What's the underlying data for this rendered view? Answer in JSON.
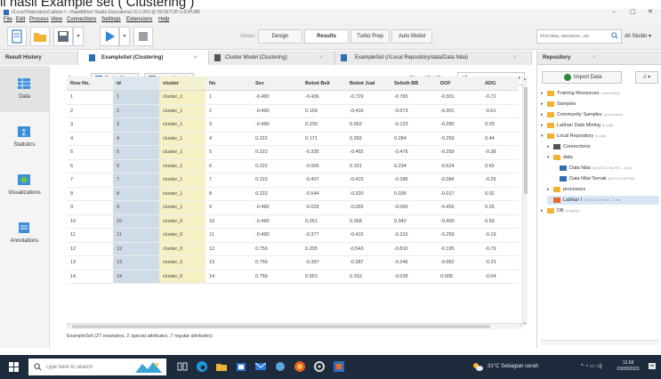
{
  "caption": "il hasil Example set ( Clustering )",
  "titlebar": {
    "title": "//Local Repository/Latihan I – RapidMiner Studio Educational 10.1.003 @ DESKTOP-UJDPU8B",
    "minimize": "–",
    "maximize": "▢",
    "close": "✕"
  },
  "menubar": [
    "File",
    "Edit",
    "Process",
    "View",
    "Connections",
    "Settings",
    "Extensions",
    "Help"
  ],
  "toolbar": {
    "views_label": "Views:",
    "perspectives": [
      "Design",
      "Results",
      "Turbo Prep",
      "Auto Model"
    ],
    "active_perspective": "Results",
    "search_placeholder": "Find data, operators...etc",
    "studio_menu": "All Studio ▾",
    "dropdown_glyph": "▾"
  },
  "main": {
    "result_history_label": "Result History",
    "tabs": [
      {
        "label": "ExampleSet (Clustering)",
        "close": "×"
      },
      {
        "label": "Cluster Model (Clustering)",
        "close": "×"
      },
      {
        "label": "ExampleSet (//Local Repository/data/Data Nilai)",
        "close": "×"
      }
    ],
    "side_nav": [
      "Data",
      "Statistics",
      "Visualizations",
      "Annotations"
    ],
    "open_in_label": "Open in",
    "turbo_prep_label": "Turbo Prep",
    "auto_model_label": "Auto Model",
    "filter_label": "Filter (27 / 27 examples):",
    "filter_value": "all",
    "filter_caret": "▾",
    "columns": [
      "Row No.",
      "id",
      "cluster",
      "No",
      "Sex",
      "Bobot Beli",
      "Bobot Jual",
      "Selisih BB",
      "DOF",
      "ADG"
    ],
    "rows": [
      [
        "1",
        "1",
        "cluster_1",
        "1",
        "-0.490",
        "-0.436",
        "-0.729",
        "-0.765",
        "-0.301",
        "-0.72"
      ],
      [
        "2",
        "2",
        "cluster_1",
        "2",
        "-0.490",
        "0.159",
        "-0.410",
        "-0.673",
        "-0.301",
        "-0.61"
      ],
      [
        "3",
        "3",
        "cluster_1",
        "3",
        "-0.490",
        "0.239",
        "0.062",
        "-0.123",
        "-0.280",
        "0.03"
      ],
      [
        "4",
        "4",
        "cluster_1",
        "4",
        "0.222",
        "0.171",
        "0.282",
        "0.284",
        "-0.259",
        "0.44"
      ],
      [
        "5",
        "5",
        "cluster_1",
        "5",
        "0.222",
        "-0.335",
        "-0.492",
        "-0.476",
        "-0.259",
        "-0.38"
      ],
      [
        "6",
        "6",
        "cluster_1",
        "6",
        "0.222",
        "-0.005",
        "0.151",
        "0.234",
        "-0.524",
        "0.60"
      ],
      [
        "7",
        "7",
        "cluster_1",
        "7",
        "0.222",
        "-0.407",
        "-0.415",
        "-0.286",
        "-0.084",
        "-0.26"
      ],
      [
        "8",
        "8",
        "cluster_1",
        "8",
        "0.222",
        "-0.544",
        "-0.320",
        "0.036",
        "-0.017",
        "0.02"
      ],
      [
        "9",
        "9",
        "cluster_1",
        "9",
        "-0.490",
        "-0.029",
        "-0.055",
        "-0.060",
        "-0.455",
        "0.25"
      ],
      [
        "10",
        "10",
        "cluster_0",
        "10",
        "-0.490",
        "0.261",
        "0.368",
        "0.342",
        "-0.400",
        "0.59"
      ],
      [
        "11",
        "11",
        "cluster_0",
        "11",
        "-0.490",
        "-0.377",
        "-0.415",
        "-0.315",
        "-0.259",
        "-0.19"
      ],
      [
        "12",
        "12",
        "cluster_0",
        "12",
        "0.756",
        "0.205",
        "-0.543",
        "-0.810",
        "-0.195",
        "-0.79"
      ],
      [
        "13",
        "13",
        "cluster_0",
        "13",
        "0.756",
        "-0.397",
        "-0.387",
        "-0.246",
        "-0.062",
        "-0.23"
      ],
      [
        "14",
        "14",
        "cluster_0",
        "14",
        "0.756",
        "0.553",
        "0.332",
        "-0.028",
        "0.006",
        "-0.04"
      ]
    ],
    "status": "ExampleSet (27 examples, 2 special attributes, 7 regular attributes)"
  },
  "repository": {
    "title": "Repository",
    "close": "×",
    "import_label": "Import Data",
    "menu_label": "≡ ▾",
    "tree": [
      {
        "label": "Training Resources",
        "sub": "(connected)",
        "indent": 0,
        "tw": "▸",
        "icon": "folder-icon"
      },
      {
        "label": "Samples",
        "sub": "",
        "indent": 0,
        "tw": "▸",
        "icon": "folder-icon"
      },
      {
        "label": "Community Samples",
        "sub": "(connected)",
        "indent": 0,
        "tw": "▸",
        "icon": "folder-icon"
      },
      {
        "label": "Latihan Data Mining",
        "sub": "(Local)",
        "indent": 0,
        "tw": "▸",
        "icon": "folder-icon"
      },
      {
        "label": "Local Repository",
        "sub": "(Local)",
        "indent": 0,
        "tw": "▾",
        "icon": "folder-icon"
      },
      {
        "label": "Connections",
        "sub": "",
        "indent": 1,
        "tw": "▸",
        "icon": "connection-icon"
      },
      {
        "label": "data",
        "sub": "",
        "indent": 1,
        "tw": "▾",
        "icon": "folder-icon"
      },
      {
        "label": "Data Nilai",
        "sub": "(8/3/23 12:46 PM – 4 kB)",
        "indent": 2,
        "tw": "",
        "icon": "data-icon"
      },
      {
        "label": "Data Nilai Ternak",
        "sub": "(8/1/23 8:50 PM)",
        "indent": 2,
        "tw": "",
        "icon": "data-icon"
      },
      {
        "label": "processes",
        "sub": "",
        "indent": 1,
        "tw": "▸",
        "icon": "folder-icon"
      },
      {
        "label": "Latihan I",
        "sub": "(8/3/23 8:20 AM – 2 kB)",
        "indent": 1,
        "tw": "",
        "icon": "process-icon"
      },
      {
        "label": "DB",
        "sub": "(Legacy)",
        "indent": 0,
        "tw": "▸",
        "icon": "folder-icon"
      }
    ]
  },
  "taskbar": {
    "search_placeholder": "Type here to search",
    "weather": "31°C  Sebagian cerah",
    "tray": "^ ◔ ▭ ◁)",
    "time": "12.58",
    "date": "03/08/2023"
  },
  "colors": {
    "id_column": "#cfdce8",
    "cluster_column": "#f6f1c4",
    "accent_blue": "#2f6eb5",
    "taskbar": "#1e2b3c"
  }
}
